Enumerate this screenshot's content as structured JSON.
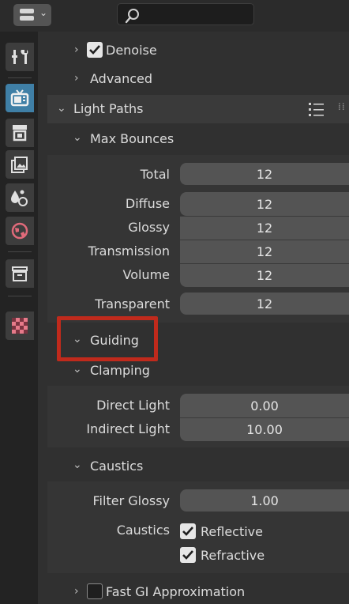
{
  "header": {
    "search": {
      "placeholder": ""
    }
  },
  "tabs": [
    {
      "name": "tool",
      "icon": "tool-icon"
    },
    {
      "name": "render",
      "icon": "render-icon",
      "active": true
    },
    {
      "name": "output",
      "icon": "output-icon"
    },
    {
      "name": "view-layer",
      "icon": "view-layer-icon"
    },
    {
      "name": "scene",
      "icon": "scene-icon"
    },
    {
      "name": "world",
      "icon": "world-icon"
    },
    {
      "name": "collection",
      "icon": "collection-icon"
    },
    {
      "name": "texture",
      "icon": "texture-icon"
    }
  ],
  "panel": {
    "denoise": {
      "label": "Denoise",
      "checked": true
    },
    "advanced": {
      "label": "Advanced"
    },
    "light_paths": {
      "label": "Light Paths",
      "max_bounces": {
        "label": "Max Bounces",
        "total": {
          "label": "Total",
          "value": "12"
        },
        "diffuse": {
          "label": "Diffuse",
          "value": "12"
        },
        "glossy": {
          "label": "Glossy",
          "value": "12"
        },
        "transmission": {
          "label": "Transmission",
          "value": "12"
        },
        "volume": {
          "label": "Volume",
          "value": "12"
        },
        "transparent": {
          "label": "Transparent",
          "value": "12"
        }
      },
      "guiding": {
        "label": "Guiding"
      },
      "clamping": {
        "label": "Clamping",
        "direct_light": {
          "label": "Direct Light",
          "value": "0.00"
        },
        "indirect_light": {
          "label": "Indirect Light",
          "value": "10.00"
        }
      },
      "caustics": {
        "label": "Caustics",
        "filter_glossy": {
          "label": "Filter Glossy",
          "value": "1.00"
        },
        "caustics_label": "Caustics",
        "reflective": {
          "label": "Reflective",
          "checked": true
        },
        "refractive": {
          "label": "Refractive",
          "checked": true
        }
      },
      "fast_gi": {
        "label": "Fast GI Approximation",
        "checked": false
      }
    }
  },
  "colors": {
    "active_tab": "#3f7fa6",
    "highlight": "#c02a1c"
  }
}
